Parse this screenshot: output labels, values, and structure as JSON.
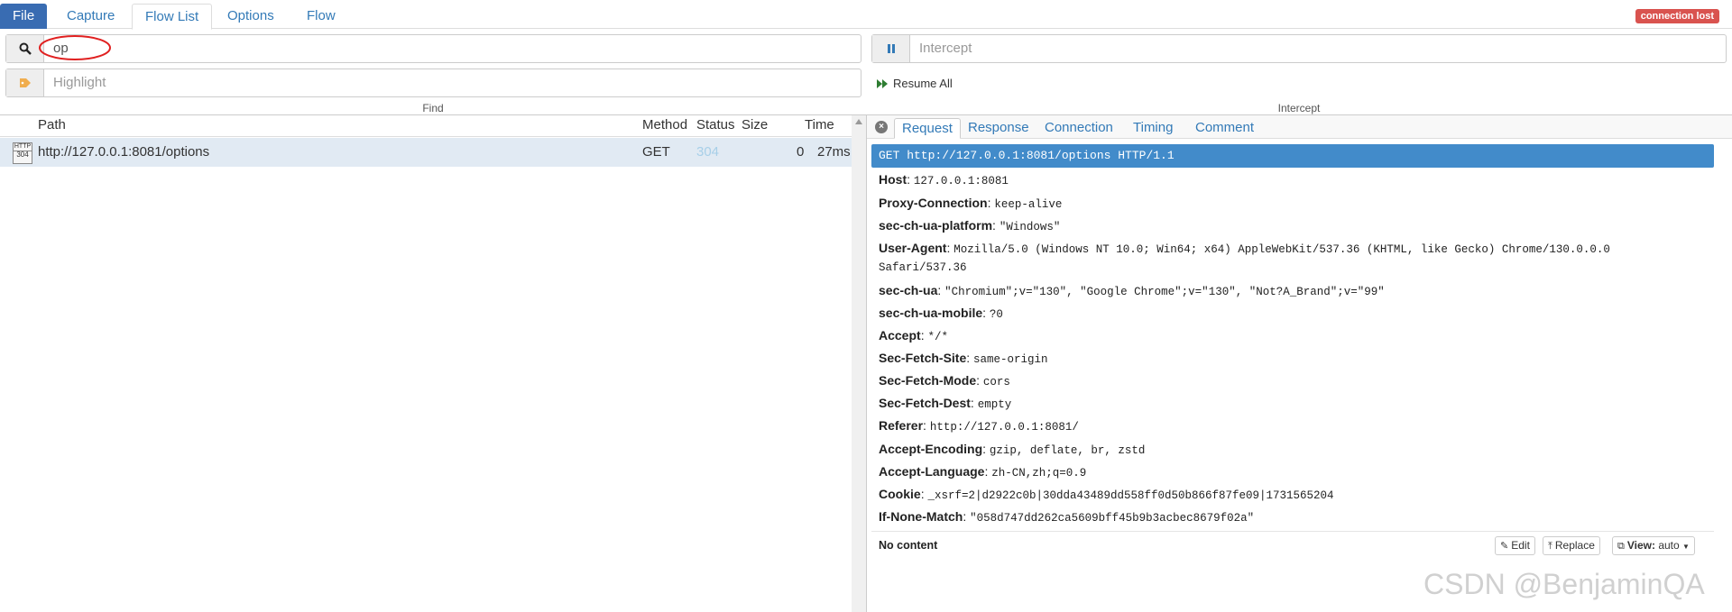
{
  "menu": {
    "tabs": [
      "File",
      "Capture",
      "Flow List",
      "Options",
      "Flow"
    ],
    "active": "Flow List",
    "connection_status": "connection lost"
  },
  "find": {
    "search_value": "op",
    "highlight_placeholder": "Highlight",
    "caption": "Find"
  },
  "intercept": {
    "placeholder": "Intercept",
    "resume_all_label": "Resume All",
    "caption": "Intercept"
  },
  "flow_list": {
    "columns": [
      "Path",
      "Method",
      "Status",
      "Size",
      "Time"
    ],
    "rows": [
      {
        "icon_text": "HTTP 304",
        "path": "http://127.0.0.1:8081/options",
        "method": "GET",
        "status": "304",
        "size": "0",
        "time": "27ms"
      }
    ]
  },
  "detail": {
    "tabs": [
      "Request",
      "Response",
      "Connection",
      "Timing",
      "Comment"
    ],
    "active_tab": "Request",
    "first_line": "GET http://127.0.0.1:8081/options HTTP/1.1",
    "headers": [
      {
        "name": "Host",
        "value": "127.0.0.1:8081"
      },
      {
        "name": "Proxy-Connection",
        "value": "keep-alive"
      },
      {
        "name": "sec-ch-ua-platform",
        "value": "\"Windows\""
      },
      {
        "name": "User-Agent",
        "value": "Mozilla/5.0 (Windows NT 10.0; Win64; x64) AppleWebKit/537.36 (KHTML, like Gecko) Chrome/130.0.0.0"
      },
      {
        "name": "sec-ch-ua",
        "value": "\"Chromium\";v=\"130\", \"Google Chrome\";v=\"130\", \"Not?A_Brand\";v=\"99\""
      },
      {
        "name": "sec-ch-ua-mobile",
        "value": "?0"
      },
      {
        "name": "Accept",
        "value": "*/*"
      },
      {
        "name": "Sec-Fetch-Site",
        "value": "same-origin"
      },
      {
        "name": "Sec-Fetch-Mode",
        "value": "cors"
      },
      {
        "name": "Sec-Fetch-Dest",
        "value": "empty"
      },
      {
        "name": "Referer",
        "value": "http://127.0.0.1:8081/"
      },
      {
        "name": "Accept-Encoding",
        "value": "gzip, deflate, br, zstd"
      },
      {
        "name": "Accept-Language",
        "value": "zh-CN,zh;q=0.9"
      },
      {
        "name": "Cookie",
        "value": "_xsrf=2|d2922c0b|30dda43489dd558ff0d50b866f87fe09|1731565204"
      },
      {
        "name": "If-None-Match",
        "value": "\"058d747dd262ca5609bff45b9b3acbec8679f02a\""
      }
    ],
    "user_agent_continuation": "Safari/537.36",
    "no_content_label": "No content",
    "edit_label": "Edit",
    "replace_label": "Replace",
    "view_label": "View:",
    "view_value": "auto"
  },
  "watermark": "CSDN @BenjaminQA"
}
